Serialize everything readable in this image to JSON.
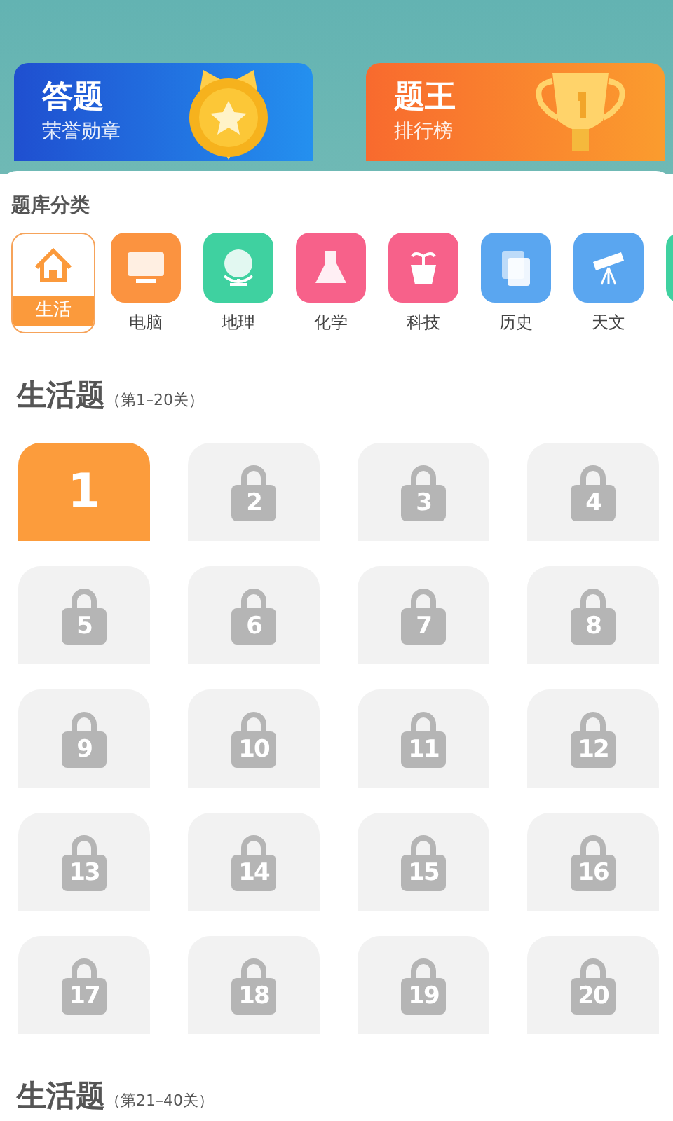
{
  "banners": [
    {
      "title": "答题",
      "subtitle": "荣誉勋章",
      "kind": "medal"
    },
    {
      "title": "题王",
      "subtitle": "排行榜",
      "kind": "trophy"
    }
  ],
  "category_title": "题库分类",
  "categories": [
    {
      "label": "生活",
      "selected": true,
      "color": "#fb9a3c"
    },
    {
      "label": "电脑",
      "selected": false,
      "color": "#fb9340"
    },
    {
      "label": "地理",
      "selected": false,
      "color": "#3fd1a0"
    },
    {
      "label": "化学",
      "selected": false,
      "color": "#f7618a"
    },
    {
      "label": "科技",
      "selected": false,
      "color": "#f7618a"
    },
    {
      "label": "历史",
      "selected": false,
      "color": "#5aa6f0"
    },
    {
      "label": "天文",
      "selected": false,
      "color": "#5aa6f0"
    },
    {
      "selected": false,
      "color": "#3fd1a0"
    }
  ],
  "sections": [
    {
      "title": "生活题",
      "range": "（第1–20关）",
      "levels": [
        {
          "number": "1",
          "locked": false
        },
        {
          "number": "2",
          "locked": true
        },
        {
          "number": "3",
          "locked": true
        },
        {
          "number": "4",
          "locked": true
        },
        {
          "number": "5",
          "locked": true
        },
        {
          "number": "6",
          "locked": true
        },
        {
          "number": "7",
          "locked": true
        },
        {
          "number": "8",
          "locked": true
        },
        {
          "number": "9",
          "locked": true
        },
        {
          "number": "10",
          "locked": true
        },
        {
          "number": "11",
          "locked": true
        },
        {
          "number": "12",
          "locked": true
        },
        {
          "number": "13",
          "locked": true
        },
        {
          "number": "14",
          "locked": true
        },
        {
          "number": "15",
          "locked": true
        },
        {
          "number": "16",
          "locked": true
        },
        {
          "number": "17",
          "locked": true
        },
        {
          "number": "18",
          "locked": true
        },
        {
          "number": "19",
          "locked": true
        },
        {
          "number": "20",
          "locked": true
        }
      ]
    },
    {
      "title": "生活题",
      "range": "（第21–40关）"
    }
  ]
}
